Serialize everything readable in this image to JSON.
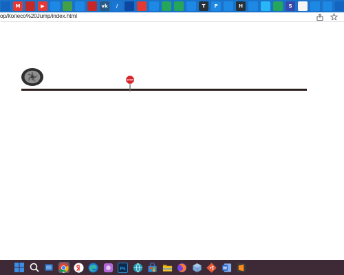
{
  "browser": {
    "url": "op/Колесо%20Jump/index.html",
    "bookmarks": [
      {
        "icon": "settings-icon",
        "color": "#1565c0",
        "glyph": ""
      },
      {
        "icon": "mail-icon",
        "color": "#e53935",
        "glyph": "M"
      },
      {
        "icon": "circle-icon",
        "color": "#c62828",
        "glyph": ""
      },
      {
        "icon": "youtube-icon",
        "color": "#e53935",
        "glyph": "▶"
      },
      {
        "icon": "link-icon",
        "color": "#1e88e5",
        "glyph": ""
      },
      {
        "icon": "green-icon",
        "color": "#43a047",
        "glyph": ""
      },
      {
        "icon": "chat-icon",
        "color": "#1e88e5",
        "glyph": ""
      },
      {
        "icon": "red-icon",
        "color": "#c62828",
        "glyph": ""
      },
      {
        "icon": "vk-icon",
        "color": "#2a5885",
        "glyph": "vk"
      },
      {
        "icon": "code-icon",
        "color": "#1976d2",
        "glyph": "/"
      },
      {
        "icon": "earth-icon",
        "color": "#0d47a1",
        "glyph": ""
      },
      {
        "icon": "diamond-icon",
        "color": "#e53935",
        "glyph": ""
      },
      {
        "icon": "chat-icon",
        "color": "#1e88e5",
        "glyph": ""
      },
      {
        "icon": "green-box-icon",
        "color": "#26a65b",
        "glyph": ""
      },
      {
        "icon": "green-box-icon",
        "color": "#26a65b",
        "glyph": ""
      },
      {
        "icon": "chat-icon",
        "color": "#1e88e5",
        "glyph": ""
      },
      {
        "icon": "text-icon",
        "color": "#263238",
        "glyph": "T"
      },
      {
        "icon": "p-icon",
        "color": "#1e88e5",
        "glyph": "P"
      },
      {
        "icon": "chat-icon",
        "color": "#1e88e5",
        "glyph": ""
      },
      {
        "icon": "h-icon",
        "color": "#263238",
        "glyph": "H"
      },
      {
        "icon": "chat-icon",
        "color": "#1e88e5",
        "glyph": ""
      },
      {
        "icon": "telegram-icon",
        "color": "#29b6f6",
        "glyph": ""
      },
      {
        "icon": "globe-icon",
        "color": "#26a65b",
        "glyph": ""
      },
      {
        "icon": "s-icon",
        "color": "#3949ab",
        "glyph": "S"
      },
      {
        "icon": "mail-icon",
        "color": "#f5f5f5",
        "glyph": ""
      },
      {
        "icon": "chat-icon",
        "color": "#1e88e5",
        "glyph": ""
      },
      {
        "icon": "chat-icon",
        "color": "#1e88e5",
        "glyph": ""
      },
      {
        "icon": "grid-icon",
        "color": "#1565c0",
        "glyph": ""
      },
      {
        "icon": "chat-icon",
        "color": "#1e88e5",
        "glyph": ""
      }
    ]
  },
  "game": {
    "stop_sign_text": "STOP"
  },
  "taskbar": {
    "apps": [
      {
        "icon": "windows-start-icon",
        "color": "#3a8ee6",
        "running": false
      },
      {
        "icon": "search-icon",
        "color": "#ffffff",
        "running": false
      },
      {
        "icon": "task-view-icon",
        "color": "#6aa7e8",
        "running": false
      },
      {
        "icon": "chrome-icon",
        "color": "#ffffff",
        "running": true
      },
      {
        "icon": "yandex-browser-icon",
        "color": "#ffffff",
        "running": true
      },
      {
        "icon": "edge-icon",
        "color": "#2fb6a6",
        "running": false
      },
      {
        "icon": "purple-app-icon",
        "color": "#b06ad8",
        "running": false
      },
      {
        "icon": "photoshop-icon",
        "color": "#0c2a4a",
        "running": false
      },
      {
        "icon": "globe-app-icon",
        "color": "#2aa0b8",
        "running": false
      },
      {
        "icon": "store-icon",
        "color": "#3f7fd6",
        "running": false
      },
      {
        "icon": "file-explorer-icon",
        "color": "#f2c230",
        "running": false
      },
      {
        "icon": "firefox-icon",
        "color": "#ff7a28",
        "running": false
      },
      {
        "icon": "virtualbox-icon",
        "color": "#7aa9d8",
        "running": false
      },
      {
        "icon": "git-icon",
        "color": "#e85a3a",
        "running": false
      },
      {
        "icon": "word-icon",
        "color": "#2b63c6",
        "running": false
      },
      {
        "icon": "sublime-icon",
        "color": "#ff8c1a",
        "running": false
      }
    ]
  }
}
